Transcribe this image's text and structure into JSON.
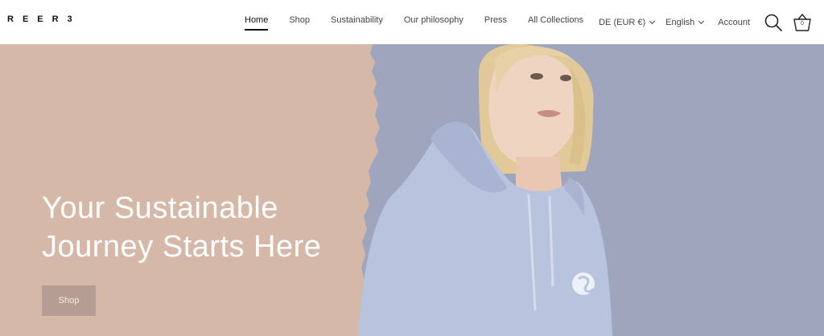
{
  "brand": {
    "logo": "REER3"
  },
  "nav": {
    "items": [
      {
        "label": "Home",
        "active": true
      },
      {
        "label": "Shop"
      },
      {
        "label": "Sustainability"
      },
      {
        "label": "Our philosophy"
      },
      {
        "label": "Press"
      },
      {
        "label": "All Collections"
      }
    ]
  },
  "utilities": {
    "currency": "DE (EUR €)",
    "language": "English",
    "account": "Account",
    "cart_count": "0"
  },
  "hero": {
    "title_line1": "Your Sustainable",
    "title_line2": "Journey Starts Here",
    "button_label": "Shop",
    "colors": {
      "left_panel": "#d5b8a8",
      "right_panel": "#9ea5bd",
      "button": "#b69d93"
    }
  }
}
